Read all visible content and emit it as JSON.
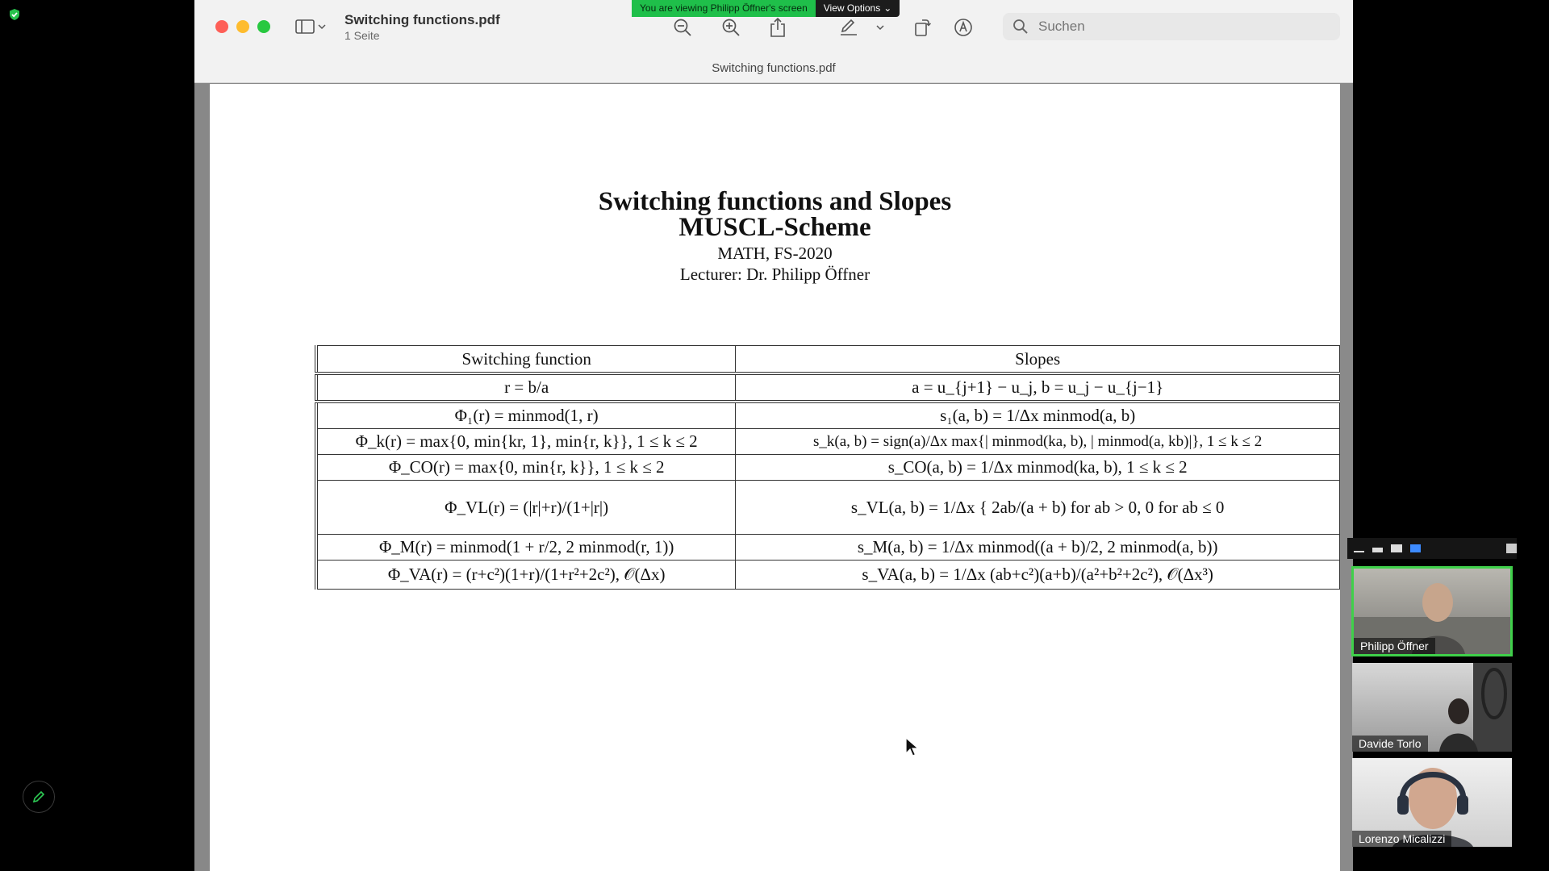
{
  "banner": {
    "message": "You are viewing Philipp Öffner's screen",
    "options_label": "View Options"
  },
  "preview": {
    "title": "Switching functions.pdf",
    "pages": "1 Seite",
    "subtitle": "Switching functions.pdf",
    "search": {
      "placeholder": "Suchen"
    },
    "icons": [
      "sidebar-icon",
      "zoom-out-icon",
      "zoom-in-icon",
      "share-icon",
      "markup-pen-icon",
      "chevron-down-icon",
      "rotate-icon",
      "annotate-icon",
      "search-icon"
    ]
  },
  "document": {
    "title": "Switching functions and Slopes",
    "subtitle": "MUSCL-Scheme",
    "course": "MATH, FS-2020",
    "lecturer": "Lecturer: Dr. Philipp Öffner",
    "table": {
      "headers": [
        "Switching function",
        "Slopes"
      ],
      "rows": [
        {
          "left": "r = b/a",
          "right": "a = u_{j+1} − u_j,   b = u_j − u_{j−1}"
        },
        {
          "left": "Φ₁(r) = minmod(1, r)",
          "right": "s₁(a, b) = 1/Δx minmod(a, b)"
        },
        {
          "left": "Φ_k(r) = max{0, min{kr, 1}, min{r, k}},  1 ≤ k ≤ 2",
          "right": "s_k(a, b) = sign(a)/Δx max{| minmod(ka, b), | minmod(a, kb)|},  1 ≤ k ≤ 2"
        },
        {
          "left": "Φ_CO(r) = max{0, min{r, k}},  1 ≤ k ≤ 2",
          "right": "s_CO(a, b) = 1/Δx minmod(ka, b),  1 ≤ k ≤ 2"
        },
        {
          "left": "Φ_VL(r) = (|r|+r)/(1+|r|)",
          "right": "s_VL(a, b) = 1/Δx { 2ab/(a + b) for ab > 0,  0 for ab ≤ 0"
        },
        {
          "left": "Φ_M(r) = minmod(1 + r/2, 2 minmod(r, 1))",
          "right": "s_M(a, b) = 1/Δx minmod((a + b)/2, 2 minmod(a, b))"
        },
        {
          "left": "Φ_VA(r) = (r+c²)(1+r)/(1+r²+2c²),  𝒪(Δx)",
          "right": "s_VA(a, b) = 1/Δx (ab+c²)(a+b)/(a²+b²+2c²),  𝒪(Δx³)"
        }
      ]
    }
  },
  "participants": [
    {
      "name": "Philipp Öffner",
      "active": true
    },
    {
      "name": "Davide Torlo",
      "active": false
    },
    {
      "name": "Lorenzo Micalizzi",
      "active": false
    }
  ],
  "colors": {
    "active_speaker": "#3fd04a",
    "banner": "#1fbf4a",
    "close": "#fe5f57",
    "minimize": "#febc2e",
    "maximize": "#28c840"
  }
}
